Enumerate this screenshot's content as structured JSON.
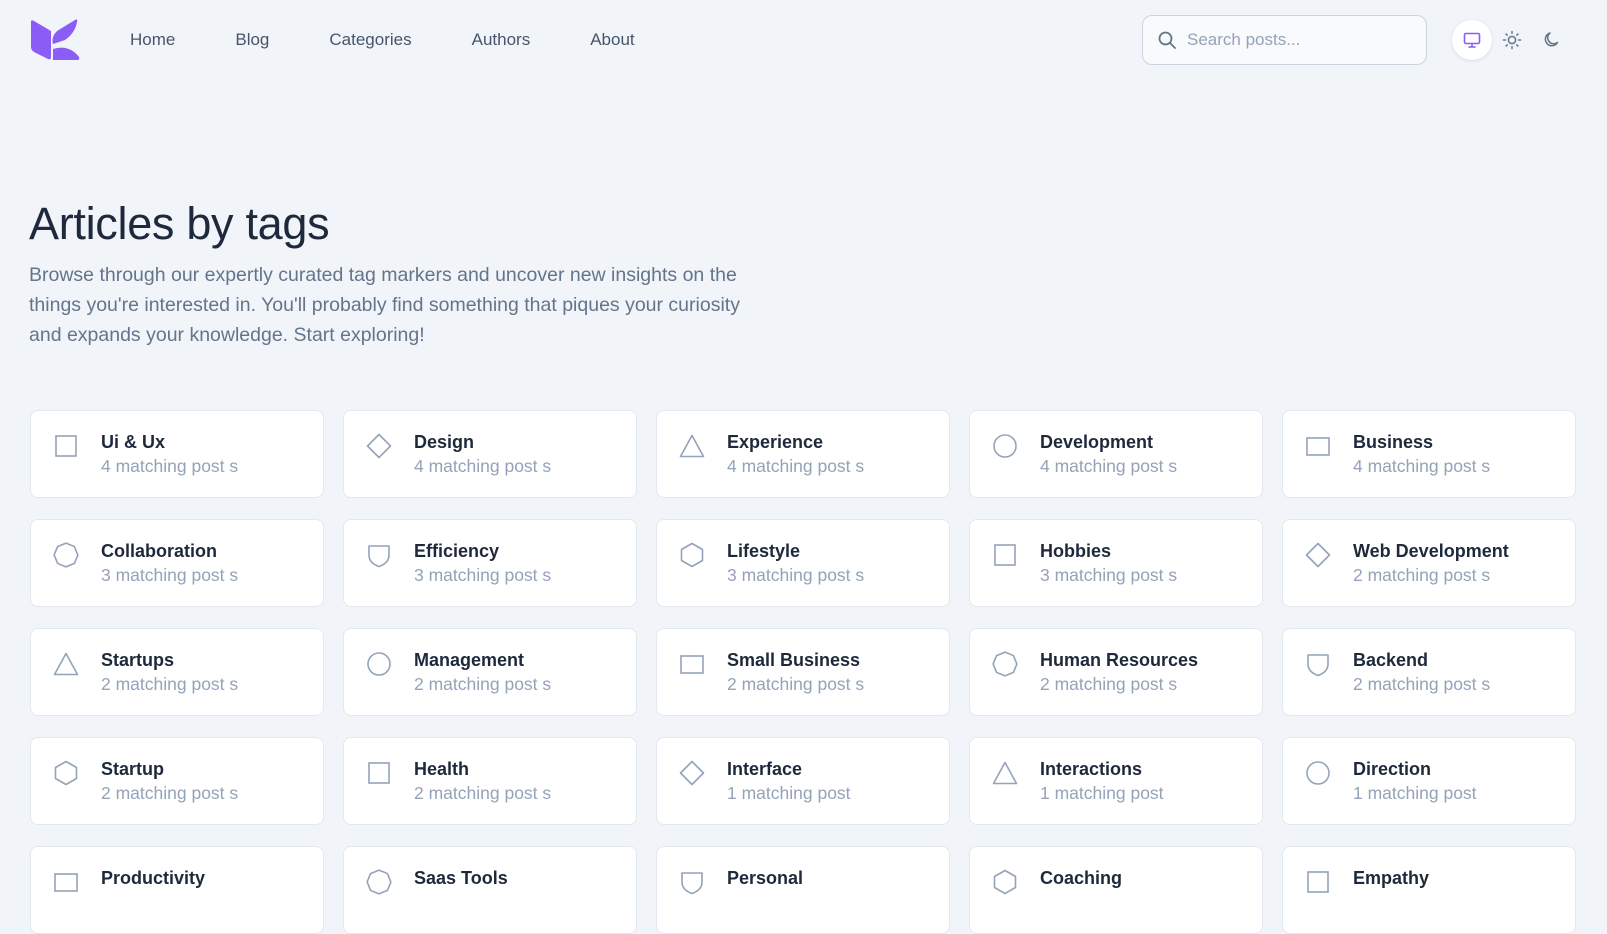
{
  "nav": [
    "Home",
    "Blog",
    "Categories",
    "Authors",
    "About"
  ],
  "search": {
    "placeholder": "Search posts..."
  },
  "theme": {
    "active": "system"
  },
  "hero": {
    "title": "Articles by tags",
    "description": "Browse through our expertly curated tag markers and uncover new insights on the things you're interested in. You'll probably find something that piques your curiosity and expands your knowledge. Start exploring!"
  },
  "colors": {
    "accent": "#8b5cf6",
    "icon": "#94a3b8"
  },
  "tags": [
    {
      "name": "Ui & Ux",
      "count": "4 matching post s",
      "icon": "square-icon"
    },
    {
      "name": "Design",
      "count": "4 matching post s",
      "icon": "diamond-icon"
    },
    {
      "name": "Experience",
      "count": "4 matching post s",
      "icon": "triangle-icon"
    },
    {
      "name": "Development",
      "count": "4 matching post s",
      "icon": "circle-icon"
    },
    {
      "name": "Business",
      "count": "4 matching post s",
      "icon": "rectangle-icon"
    },
    {
      "name": "Collaboration",
      "count": "3 matching post s",
      "icon": "octagon-icon"
    },
    {
      "name": "Efficiency",
      "count": "3 matching post s",
      "icon": "shield-icon"
    },
    {
      "name": "Lifestyle",
      "count": "3 matching post s",
      "icon": "hexagon-icon"
    },
    {
      "name": "Hobbies",
      "count": "3 matching post s",
      "icon": "square-icon"
    },
    {
      "name": "Web Development",
      "count": "2 matching post s",
      "icon": "diamond-icon"
    },
    {
      "name": "Startups",
      "count": "2 matching post s",
      "icon": "triangle-icon"
    },
    {
      "name": "Management",
      "count": "2 matching post s",
      "icon": "circle-icon"
    },
    {
      "name": "Small Business",
      "count": "2 matching post s",
      "icon": "rectangle-icon"
    },
    {
      "name": "Human Resources",
      "count": "2 matching post s",
      "icon": "octagon-icon"
    },
    {
      "name": "Backend",
      "count": "2 matching post s",
      "icon": "shield-icon"
    },
    {
      "name": "Startup",
      "count": "2 matching post s",
      "icon": "hexagon-icon"
    },
    {
      "name": "Health",
      "count": "2 matching post s",
      "icon": "square-icon"
    },
    {
      "name": "Interface",
      "count": "1 matching post",
      "icon": "diamond-icon"
    },
    {
      "name": "Interactions",
      "count": "1 matching post",
      "icon": "triangle-icon"
    },
    {
      "name": "Direction",
      "count": "1 matching post",
      "icon": "circle-icon"
    },
    {
      "name": "Productivity",
      "count": "",
      "icon": "rectangle-icon"
    },
    {
      "name": "Saas Tools",
      "count": "",
      "icon": "octagon-icon"
    },
    {
      "name": "Personal",
      "count": "",
      "icon": "shield-icon"
    },
    {
      "name": "Coaching",
      "count": "",
      "icon": "hexagon-icon"
    },
    {
      "name": "Empathy",
      "count": "",
      "icon": "square-icon"
    }
  ]
}
